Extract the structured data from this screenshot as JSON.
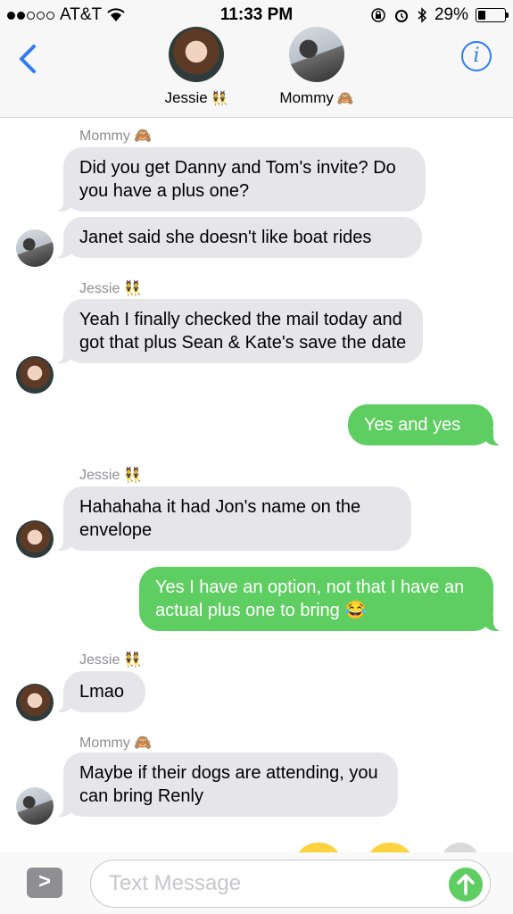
{
  "status_bar": {
    "carrier": "AT&T",
    "time": "11:33 PM",
    "battery": "29%",
    "battery_level": 0.29,
    "signal_dots_filled": 2,
    "signal_dots_total": 5
  },
  "header": {
    "contacts": [
      {
        "name": "Jessie",
        "emoji": "👯"
      },
      {
        "name": "Mommy",
        "emoji": "🙈"
      }
    ],
    "info_label": "i"
  },
  "messages": [
    {
      "sender": "Mommy",
      "emoji": "🙈",
      "text": "Did you get Danny and Tom's invite? Do you have a plus one?"
    },
    {
      "text": "Janet said she doesn't like boat rides"
    },
    {
      "sender": "Jessie",
      "emoji": "👯",
      "text": "Yeah I finally checked the mail today and got that plus Sean & Kate's save the date"
    },
    {
      "text": "Yes and yes"
    },
    {
      "sender": "Jessie",
      "emoji": "👯",
      "text": "Hahahaha it had Jon's name on the envelope"
    },
    {
      "text": "Yes I have an option, not that I have an actual plus one to bring 😂"
    },
    {
      "sender": "Jessie",
      "emoji": "👯",
      "text": "Lmao"
    },
    {
      "sender": "Mommy",
      "emoji": "🙈",
      "text": "Maybe if their dogs are attending, you can bring Renly"
    }
  ],
  "composer": {
    "placeholder": "Text Message",
    "expand_label": ">"
  },
  "colors": {
    "accent": "#2e7cf6",
    "incoming": "#e5e5ea",
    "outgoing": "#5fce62"
  }
}
